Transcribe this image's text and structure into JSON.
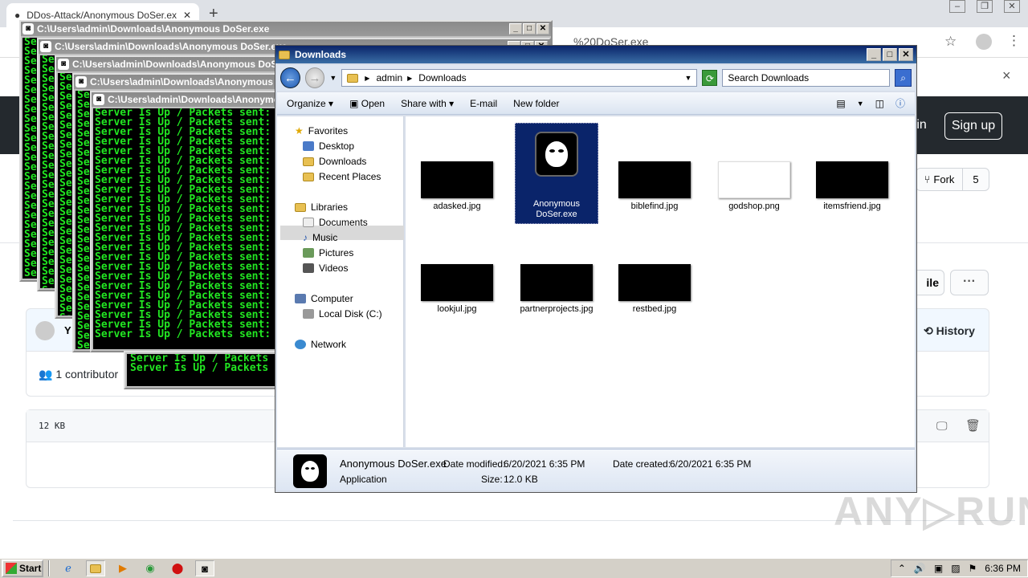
{
  "browser": {
    "tab_title": "DDos-Attack/Anonymous DoSer.exe",
    "new_tab": "+",
    "omnibox_tail": "%20DoSer.exe",
    "close_infobar": "×"
  },
  "github": {
    "sign_in": "n in",
    "sign_up": "Sign up",
    "fork_label": "Fork",
    "fork_count": "5",
    "file_button": "ile",
    "more_button": "···",
    "history": "History",
    "commit_initial": "Y",
    "contributors": "1 contributor",
    "file_size": "12 KB"
  },
  "watermark": "ANY▷RUN",
  "consoles": [
    {
      "title": "C:\\Users\\admin\\Downloads\\Anonymous DoSer.exe"
    },
    {
      "title": "C:\\Users\\admin\\Downloads\\Anonymous DoSer.exe"
    },
    {
      "title": "C:\\Users\\admin\\Downloads\\Anonymous DoSer.exe"
    },
    {
      "title": "C:\\Users\\admin\\Downloads\\Anonymous DoSer.exe"
    },
    {
      "title": "C:\\Users\\admin\\Downloads\\Anonymous DoSer.exe"
    }
  ],
  "console_text": {
    "line_full": "Server Is Up / Packets sent:",
    "line_mid": "Server Is Up / Packets",
    "line_short": "Se"
  },
  "explorer": {
    "title": "Downloads",
    "breadcrumb": [
      "admin",
      "Downloads"
    ],
    "search_placeholder": "Search Downloads",
    "toolbar": {
      "organize": "Organize",
      "open": "Open",
      "share_with": "Share with",
      "email": "E-mail",
      "new_folder": "New folder"
    },
    "nav": {
      "favorites": "Favorites",
      "desktop": "Desktop",
      "downloads": "Downloads",
      "recent_places": "Recent Places",
      "libraries": "Libraries",
      "documents": "Documents",
      "music": "Music",
      "pictures": "Pictures",
      "videos": "Videos",
      "computer": "Computer",
      "local_disk": "Local Disk (C:)",
      "network": "Network"
    },
    "files": [
      {
        "name": "adasked.jpg"
      },
      {
        "name": "Anonymous DoSer.exe"
      },
      {
        "name": "biblefind.jpg"
      },
      {
        "name": "godshop.png"
      },
      {
        "name": "itemsfriend.jpg"
      },
      {
        "name": "lookjul.jpg"
      },
      {
        "name": "partnerprojects.jpg"
      },
      {
        "name": "restbed.jpg"
      }
    ],
    "details": {
      "name": "Anonymous DoSer.exe",
      "type": "Application",
      "date_modified_label": "Date modified:",
      "date_modified": "6/20/2021 6:35 PM",
      "date_created_label": "Date created:",
      "date_created": "6/20/2021 6:35 PM",
      "size_label": "Size:",
      "size": "12.0 KB"
    }
  },
  "taskbar": {
    "start": "Start",
    "clock": "6:36 PM"
  }
}
